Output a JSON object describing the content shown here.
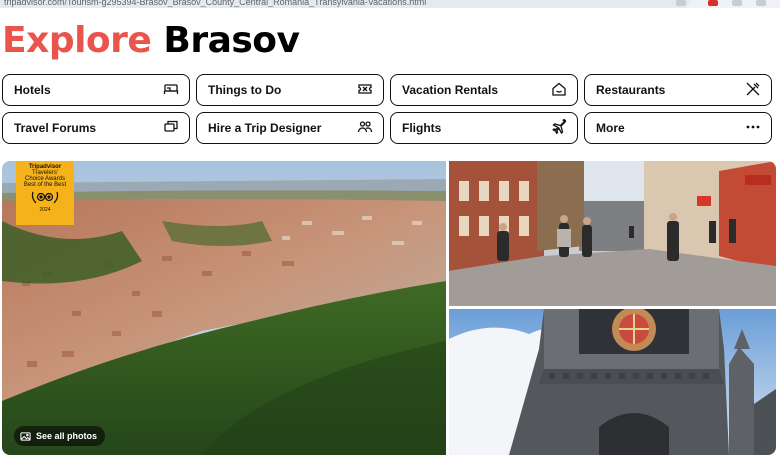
{
  "browser": {
    "url": "tripadvisor.com/Tourism-g295394-Brasov_Brasov_County_Central_Romania_Transylvania-Vacations.html"
  },
  "page": {
    "title_accent": "Explore",
    "title_main": "Brasov"
  },
  "nav": [
    {
      "label": "Hotels",
      "icon": "bed-icon"
    },
    {
      "label": "Things to Do",
      "icon": "ticket-icon"
    },
    {
      "label": "Vacation Rentals",
      "icon": "house-icon"
    },
    {
      "label": "Restaurants",
      "icon": "utensils-icon"
    },
    {
      "label": "Travel Forums",
      "icon": "chat-icon"
    },
    {
      "label": "Hire a Trip Designer",
      "icon": "people-icon"
    },
    {
      "label": "Flights",
      "icon": "plane-icon"
    },
    {
      "label": "More",
      "icon": "more-dots-icon"
    }
  ],
  "gallery": {
    "award_line1": "Tripadvisor",
    "award_line2": "Travelers'",
    "award_line3": "Choice Awards",
    "award_line4": "Best of the Best",
    "award_year": "2024",
    "see_all_label": "See all photos"
  },
  "colors": {
    "accent": "#e9554d",
    "award": "#f5b21b"
  }
}
